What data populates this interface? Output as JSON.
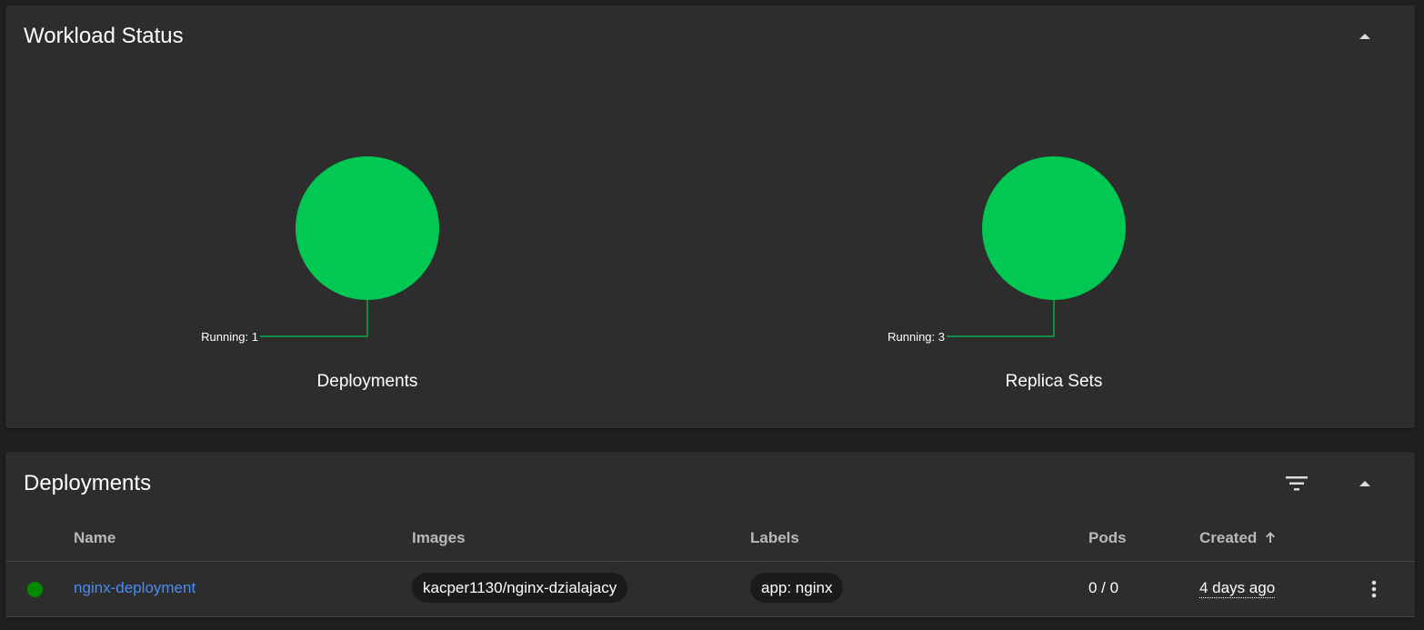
{
  "workload_status": {
    "title": "Workload Status",
    "collapse_icon": "caret-up-icon",
    "charts": [
      {
        "caption": "Deployments",
        "label": "Running: 1",
        "running": 1,
        "color": "#00c853"
      },
      {
        "caption": "Replica Sets",
        "label": "Running: 3",
        "running": 3,
        "color": "#00c853"
      }
    ]
  },
  "deployments": {
    "title": "Deployments",
    "filter_icon": "filter-icon",
    "collapse_icon": "caret-up-icon",
    "columns": {
      "name": "Name",
      "images": "Images",
      "labels": "Labels",
      "pods": "Pods",
      "created": "Created"
    },
    "sort_icon": "arrow-up-icon",
    "rows": [
      {
        "status_color": "#008a00",
        "name": "nginx-deployment",
        "image": "kacper1130/nginx-dzialajacy",
        "label": "app: nginx",
        "pods": "0 / 0",
        "created": "4 days ago",
        "menu_icon": "more-vertical-icon"
      }
    ]
  },
  "colors": {
    "background": "#202020",
    "card": "#2d2d2d",
    "running": "#00c853",
    "link": "#4b8cf2"
  }
}
